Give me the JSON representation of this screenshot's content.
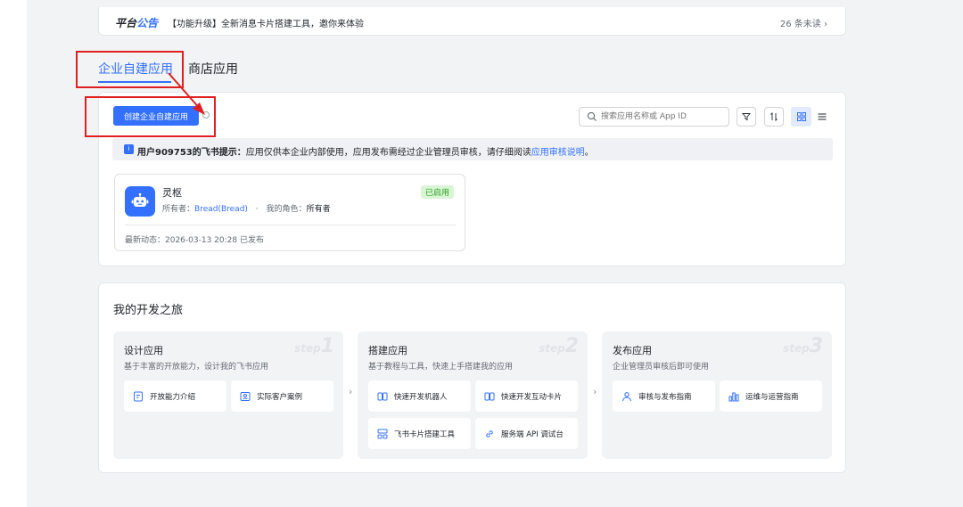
{
  "notice": {
    "logo_part1": "平台",
    "logo_part2": "公告",
    "message": "【功能升级】全新消息卡片搭建工具，邀你来体验",
    "unread": "26 条未读 ›"
  },
  "tabs": {
    "active": "企业自建应用",
    "inactive": "商店应用"
  },
  "toolbar": {
    "create_label": "创建企业自建应用",
    "search_placeholder": "搜索应用名称或 App ID"
  },
  "tip": {
    "badge": "i",
    "bold": "用户909753的飞书提示：",
    "text": "应用仅供本企业内部使用，应用发布需经过企业管理员审核，请仔细阅读",
    "link": "应用审核说明",
    "end": "。"
  },
  "app": {
    "name": "灵枢",
    "owner_label": "所有者：",
    "owner": "Bread(Bread)",
    "sep": "·",
    "role_label": "我的角色：",
    "role": "所有者",
    "status": "已启用",
    "latest": "最新动态：2026-03-13 20:28 已发布"
  },
  "journey": {
    "title": "我的开发之旅",
    "steps": [
      {
        "title": "设计应用",
        "desc": "基于丰富的开放能力，设计我的飞书应用",
        "wm_text": "step",
        "wm_num": "1",
        "items": [
          "开放能力介绍",
          "实际客户案例"
        ]
      },
      {
        "title": "搭建应用",
        "desc": "基于教程与工具，快速上手搭建我的应用",
        "wm_text": "step",
        "wm_num": "2",
        "items": [
          "快速开发机器人",
          "快速开发互动卡片",
          "飞书卡片搭建工具",
          "服务端 API 调试台"
        ]
      },
      {
        "title": "发布应用",
        "desc": "企业管理员审核后即可使用",
        "wm_text": "step",
        "wm_num": "3",
        "items": [
          "审核与发布指南",
          "运维与运营指南"
        ]
      }
    ],
    "chevron": "›"
  }
}
